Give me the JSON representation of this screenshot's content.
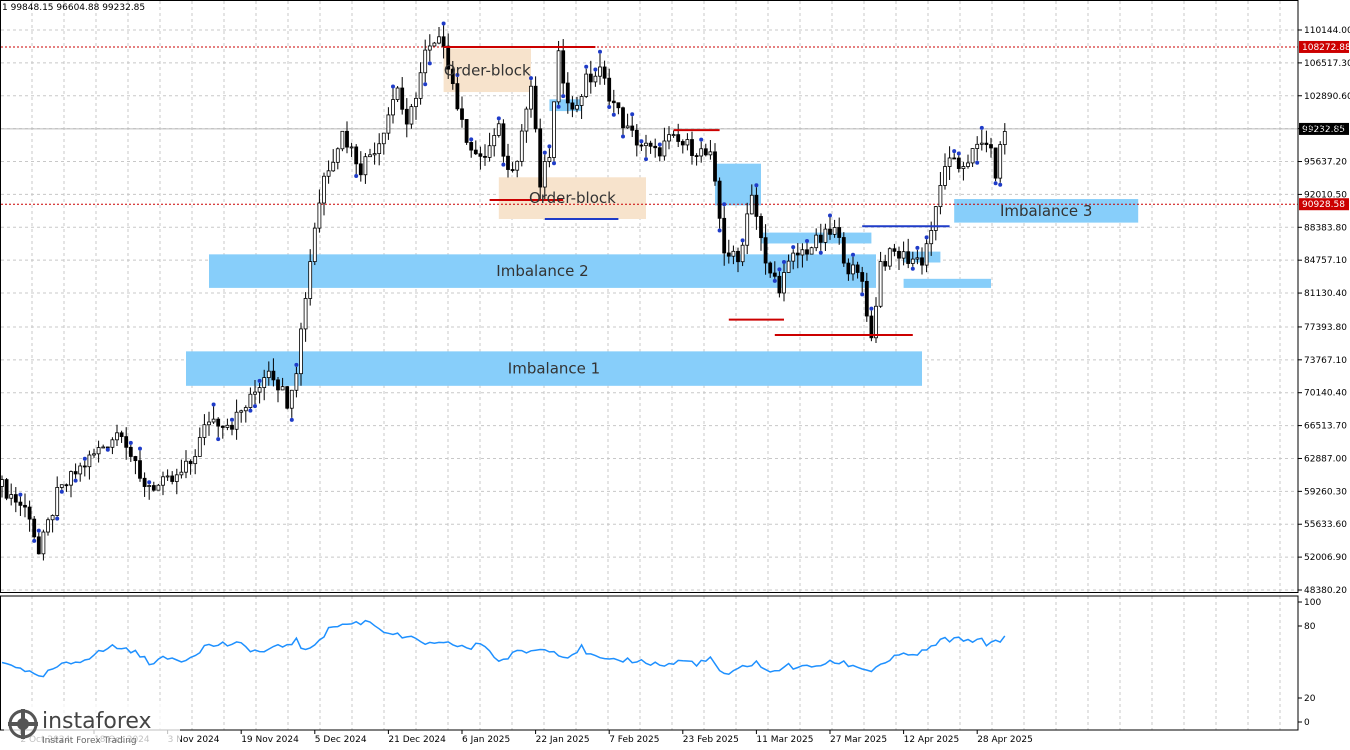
{
  "header": {
    "ohlc_text": "1 99848.15 96604.88 99232.85"
  },
  "logo": {
    "name": "instaforex",
    "tagline": "Instant Forex Trading"
  },
  "colors": {
    "candle": "#000000",
    "marker": "#1f3cc8",
    "rsi": "#1e90ff",
    "imbalance": "#87cefa",
    "orderblock": "#f7e3cc",
    "hline_red": "#cc0000",
    "hline_blue": "#1f3cc8",
    "grid": "#c8c8c8"
  },
  "chart_data": [
    {
      "type": "candlestick",
      "price_axis_ticks": [
        "110144.00",
        "106517.30",
        "102890.60",
        "99232.85",
        "95637.20",
        "92010.50",
        "88383.80",
        "84757.10",
        "81130.40",
        "77393.80",
        "73767.10",
        "70140.40",
        "66513.70",
        "62887.00",
        "59260.30",
        "55633.60",
        "52006.90",
        "48380.20"
      ],
      "price_tick_values": [
        110144.0,
        106517.3,
        102890.6,
        99263.9,
        95637.2,
        92010.5,
        88383.8,
        84757.1,
        81130.4,
        77393.8,
        73767.1,
        70140.4,
        66513.7,
        62887.0,
        59260.3,
        55633.6,
        52006.9,
        48380.2
      ],
      "ylim": [
        48380.2,
        110144.0
      ],
      "date_ticks": [
        "2 Oct 2024",
        "18 Oct 2024",
        "3 Nov 2024",
        "19 Nov 2024",
        "5 Dec 2024",
        "21 Dec 2024",
        "6 Jan 2025",
        "22 Jan 2025",
        "7 Feb 2025",
        "23 Feb 2025",
        "11 Mar 2025",
        "27 Mar 2025",
        "12 Apr 2025",
        "28 Apr 2025"
      ],
      "date_tick_index": [
        4,
        20,
        36,
        52,
        68,
        84,
        100,
        116,
        132,
        148,
        164,
        180,
        196,
        212
      ],
      "price_levels": [
        {
          "label": "108272.88",
          "value": 108272.88,
          "color": "#cc0000"
        },
        {
          "label": "99232.85",
          "value": 99232.85,
          "color": "#000000"
        },
        {
          "label": "90928.58",
          "value": 90928.58,
          "color": "#cc0000"
        }
      ],
      "zones": [
        {
          "label": "Order-block",
          "kind": "orderblock",
          "from": 96,
          "to": 115,
          "low": 103300,
          "high": 108100
        },
        {
          "label": "Order-block",
          "kind": "orderblock",
          "from": 108,
          "to": 140,
          "low": 89300,
          "high": 93900
        },
        {
          "label": "Imbalance 3",
          "kind": "imbalance",
          "from": 207,
          "to": 247,
          "low": 88900,
          "high": 91500
        },
        {
          "label": "Imbalance 2",
          "kind": "imbalance",
          "from": 45,
          "to": 190,
          "low": 81700,
          "high": 85400
        },
        {
          "label": "Imbalance 1",
          "kind": "imbalance",
          "from": 40,
          "to": 200,
          "low": 70900,
          "high": 74700
        },
        {
          "label": "",
          "kind": "imbalance",
          "from": 119,
          "to": 126,
          "low": 101200,
          "high": 102500
        },
        {
          "label": "",
          "kind": "imbalance",
          "from": 155,
          "to": 165,
          "low": 90800,
          "high": 95400
        },
        {
          "label": "",
          "kind": "imbalance",
          "from": 165,
          "to": 189,
          "low": 86600,
          "high": 87800
        },
        {
          "label": "",
          "kind": "imbalance",
          "from": 196,
          "to": 204,
          "low": 84500,
          "high": 85700
        },
        {
          "label": "",
          "kind": "imbalance",
          "from": 196,
          "to": 215,
          "low": 81700,
          "high": 82700
        }
      ],
      "segments": [
        {
          "from": 96,
          "to": 129,
          "value": 108272.88,
          "color": "#cc0000"
        },
        {
          "from": 146,
          "to": 156,
          "value": 99100,
          "color": "#cc0000"
        },
        {
          "from": 106,
          "to": 122,
          "value": 91400,
          "color": "#cc0000"
        },
        {
          "from": 118,
          "to": 134,
          "value": 89300,
          "color": "#1f3cc8"
        },
        {
          "from": 158,
          "to": 170,
          "value": 78200,
          "color": "#cc0000"
        },
        {
          "from": 168,
          "to": 198,
          "value": 76500,
          "color": "#cc0000"
        },
        {
          "from": 187,
          "to": 206,
          "value": 88500,
          "color": "#1f3cc8"
        }
      ],
      "anchors": [
        [
          0,
          59800
        ],
        [
          6,
          56800
        ],
        [
          8,
          52300
        ],
        [
          12,
          58800
        ],
        [
          16,
          61300
        ],
        [
          22,
          64300
        ],
        [
          26,
          66200
        ],
        [
          30,
          60300
        ],
        [
          34,
          59800
        ],
        [
          38,
          60600
        ],
        [
          41,
          62400
        ],
        [
          45,
          67300
        ],
        [
          50,
          66800
        ],
        [
          54,
          69300
        ],
        [
          58,
          73100
        ],
        [
          62,
          69300
        ],
        [
          64,
          73000
        ],
        [
          66,
          81000
        ],
        [
          68,
          88600
        ],
        [
          70,
          94000
        ],
        [
          74,
          98800
        ],
        [
          78,
          95000
        ],
        [
          82,
          98000
        ],
        [
          86,
          104000
        ],
        [
          88,
          99000
        ],
        [
          92,
          107500
        ],
        [
          96,
          109000
        ],
        [
          100,
          99500
        ],
        [
          104,
          95500
        ],
        [
          108,
          99000
        ],
        [
          110,
          94500
        ],
        [
          112,
          96500
        ],
        [
          115,
          104000
        ],
        [
          117,
          93000
        ],
        [
          119,
          96500
        ],
        [
          121,
          107000
        ],
        [
          124,
          101000
        ],
        [
          127,
          104500
        ],
        [
          130,
          105500
        ],
        [
          133,
          102000
        ],
        [
          136,
          99000
        ],
        [
          139,
          97500
        ],
        [
          142,
          96500
        ],
        [
          145,
          98000
        ],
        [
          148,
          97500
        ],
        [
          151,
          97000
        ],
        [
          154,
          96000
        ],
        [
          157,
          86000
        ],
        [
          160,
          84500
        ],
        [
          163,
          92500
        ],
        [
          166,
          84000
        ],
        [
          169,
          82000
        ],
        [
          172,
          85000
        ],
        [
          175,
          86000
        ],
        [
          178,
          87000
        ],
        [
          181,
          88000
        ],
        [
          184,
          84000
        ],
        [
          187,
          82500
        ],
        [
          189,
          76000
        ],
        [
          191,
          84500
        ],
        [
          194,
          85500
        ],
        [
          197,
          85000
        ],
        [
          200,
          84800
        ],
        [
          203,
          90000
        ],
        [
          205,
          95500
        ],
        [
          208,
          95000
        ],
        [
          211,
          96500
        ],
        [
          214,
          98000
        ],
        [
          216,
          94500
        ],
        [
          218,
          99200
        ]
      ],
      "rsi": {
        "ticks": [
          "100",
          "80",
          "20",
          "0"
        ],
        "tick_values": [
          100,
          80,
          20,
          0
        ],
        "ylim": [
          0,
          100
        ],
        "anchors": [
          [
            0,
            49
          ],
          [
            4,
            46
          ],
          [
            8,
            36
          ],
          [
            12,
            46
          ],
          [
            16,
            50
          ],
          [
            20,
            56
          ],
          [
            24,
            63
          ],
          [
            28,
            60
          ],
          [
            32,
            50
          ],
          [
            36,
            53
          ],
          [
            40,
            52
          ],
          [
            44,
            63
          ],
          [
            48,
            65
          ],
          [
            52,
            64
          ],
          [
            56,
            58
          ],
          [
            60,
            62
          ],
          [
            64,
            68
          ],
          [
            66,
            58
          ],
          [
            68,
            66
          ],
          [
            72,
            80
          ],
          [
            76,
            82
          ],
          [
            80,
            84
          ],
          [
            82,
            78
          ],
          [
            86,
            72
          ],
          [
            90,
            68
          ],
          [
            94,
            64
          ],
          [
            98,
            65
          ],
          [
            102,
            61
          ],
          [
            104,
            66
          ],
          [
            106,
            60
          ],
          [
            108,
            50
          ],
          [
            112,
            58
          ],
          [
            116,
            60
          ],
          [
            120,
            61
          ],
          [
            122,
            54
          ],
          [
            124,
            57
          ],
          [
            126,
            62
          ],
          [
            128,
            55
          ],
          [
            132,
            50
          ],
          [
            136,
            52
          ],
          [
            140,
            50
          ],
          [
            144,
            47
          ],
          [
            148,
            51
          ],
          [
            151,
            49
          ],
          [
            154,
            52
          ],
          [
            156,
            43
          ],
          [
            158,
            38
          ],
          [
            161,
            46
          ],
          [
            164,
            50
          ],
          [
            167,
            40
          ],
          [
            170,
            47
          ],
          [
            174,
            45
          ],
          [
            178,
            48
          ],
          [
            182,
            50
          ],
          [
            186,
            46
          ],
          [
            189,
            43
          ],
          [
            191,
            48
          ],
          [
            194,
            54
          ],
          [
            198,
            56
          ],
          [
            201,
            59
          ],
          [
            204,
            68
          ],
          [
            207,
            69
          ],
          [
            210,
            67
          ],
          [
            212,
            70
          ],
          [
            214,
            65
          ],
          [
            216,
            68
          ],
          [
            218,
            70
          ]
        ]
      }
    }
  ]
}
